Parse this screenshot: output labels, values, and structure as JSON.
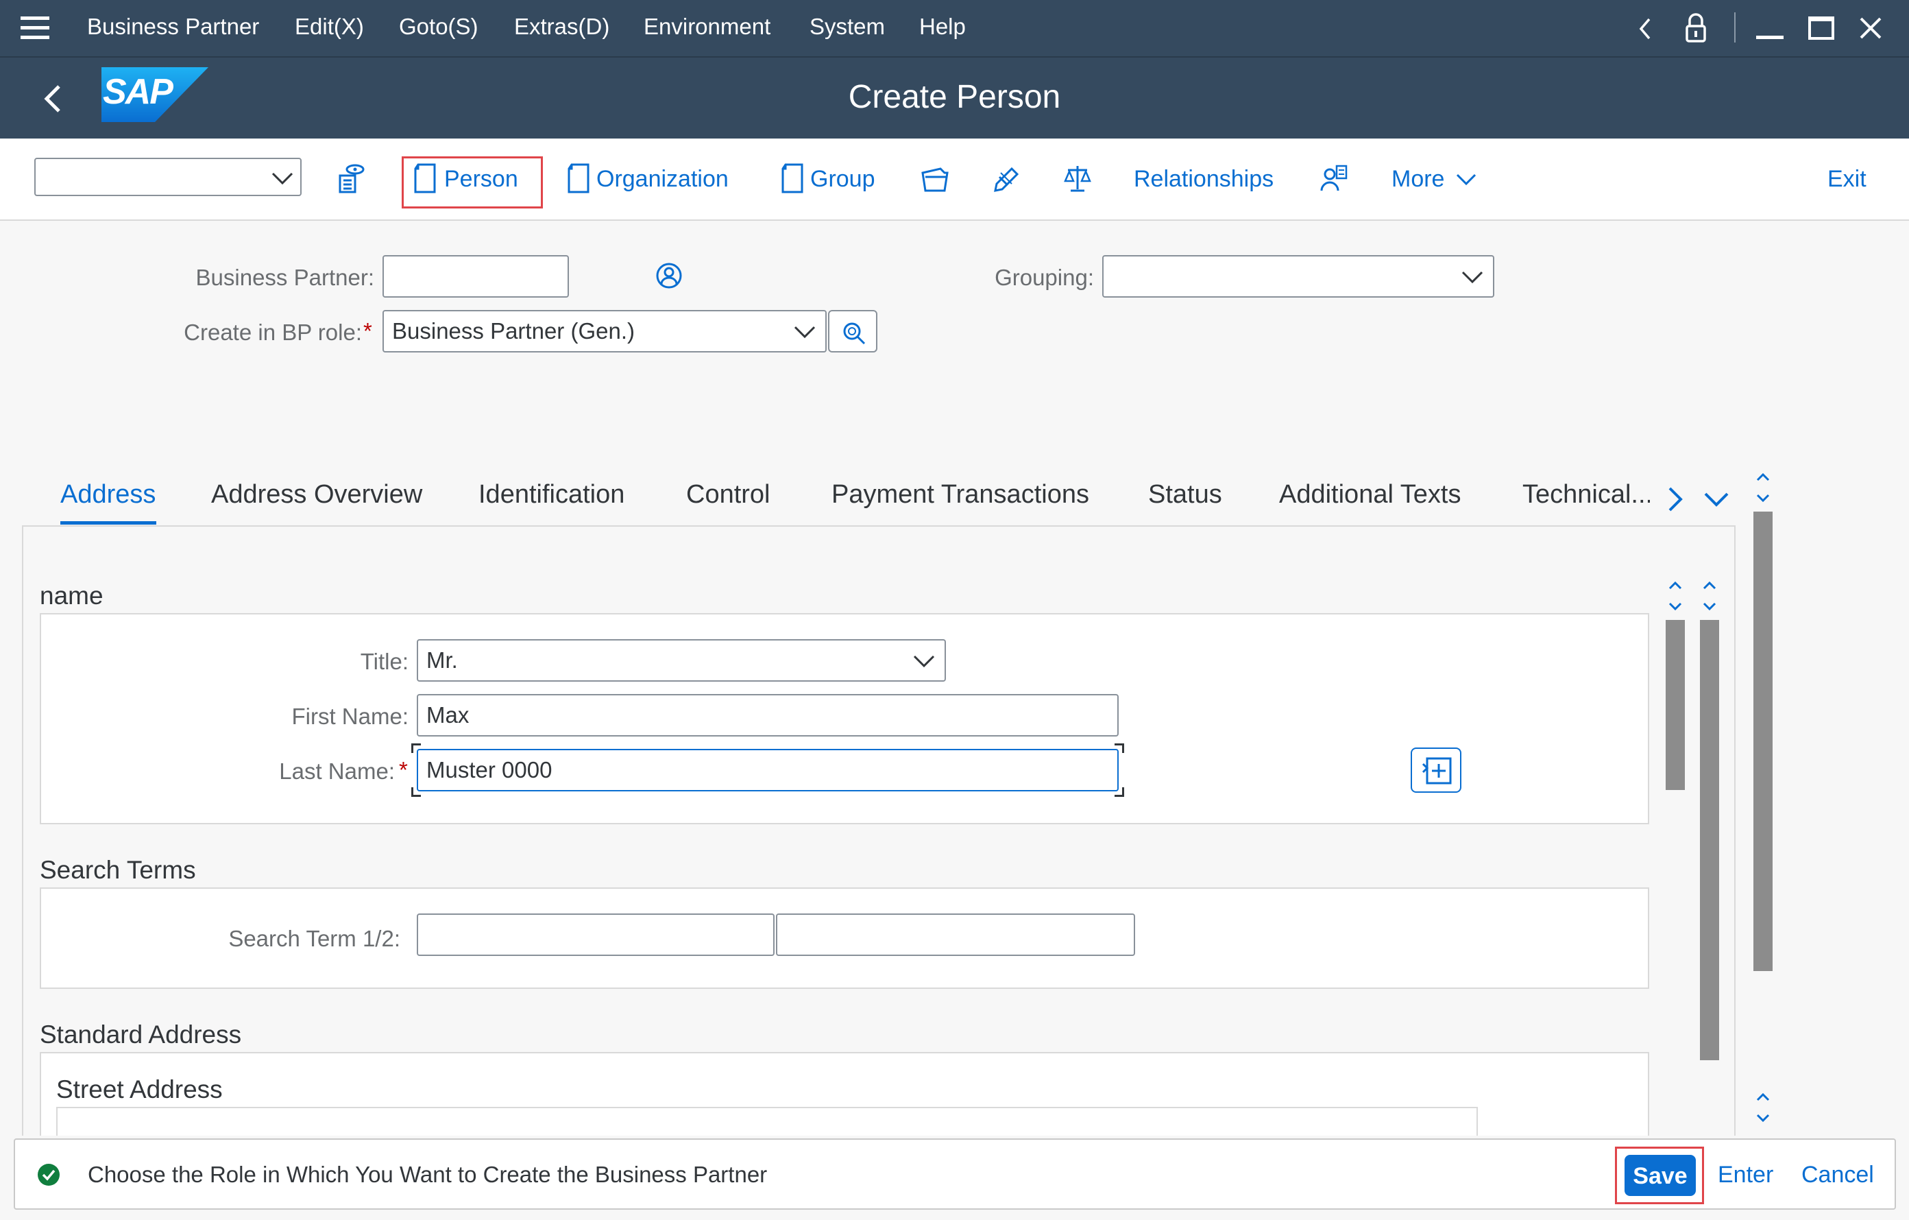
{
  "menu": {
    "items": [
      "Business Partner",
      "Edit(X)",
      "Goto(S)",
      "Extras(D)",
      "Environment",
      "System",
      "Help"
    ],
    "business_partner": "Business Partner",
    "edit": "Edit(X)",
    "goto": "Goto(S)",
    "extras": "Extras(D)",
    "environment": "Environment",
    "system": "System",
    "help": "Help"
  },
  "header": {
    "logo": "SAP",
    "title": "Create Person"
  },
  "toolbar": {
    "dropdown_value": "",
    "person": "Person",
    "organization": "Organization",
    "group": "Group",
    "relationships": "Relationships",
    "more": "More",
    "exit": "Exit"
  },
  "form": {
    "business_partner_label": "Business Partner:",
    "business_partner_value": "",
    "grouping_label": "Grouping:",
    "grouping_value": "",
    "role_label": "Create in BP role:",
    "role_required": "*",
    "role_value": "Business Partner (Gen.)"
  },
  "tabs": {
    "address": "Address",
    "address_overview": "Address Overview",
    "identification": "Identification",
    "control": "Control",
    "payment_transactions": "Payment Transactions",
    "status": "Status",
    "additional_texts": "Additional Texts",
    "technical": "Technical..."
  },
  "name_section": {
    "heading": "name",
    "title_label": "Title:",
    "title_value": "Mr.",
    "first_name_label": "First Name:",
    "first_name_value": "Max",
    "last_name_label": "Last Name:",
    "last_name_required": "*",
    "last_name_value": "Muster 0000"
  },
  "search_terms": {
    "heading": "Search Terms",
    "label": "Search Term 1/2:",
    "term1": "",
    "term2": ""
  },
  "standard_address": {
    "heading": "Standard Address",
    "street_heading": "Street Address"
  },
  "status": {
    "message": "Choose the Role in Which You Want to Create the Business Partner",
    "save": "Save",
    "enter": "Enter",
    "cancel": "Cancel"
  },
  "colors": {
    "shell": "#354a5f",
    "accent": "#0a6ed1",
    "success": "#107e3e",
    "highlight": "#e0454a"
  }
}
